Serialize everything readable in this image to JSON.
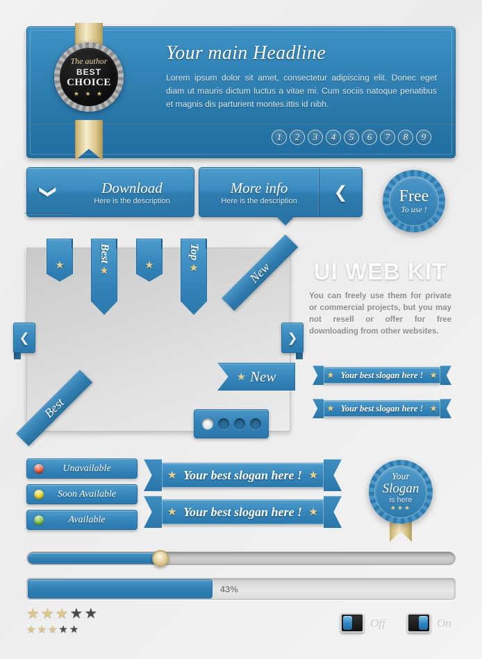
{
  "header": {
    "headline": "Your main Headline",
    "paragraph": "Lorem ipsum dolor sit amet, consectetur adipiscing elit. Donec eget diam ut mauris dictum luctus a vitae mi. Cum sociis natoque penatibus et magnis dis parturient montes.ittis id nibh.",
    "pagination": [
      "1",
      "2",
      "3",
      "4",
      "5",
      "6",
      "7",
      "8",
      "9"
    ]
  },
  "author_badge": {
    "author_line": "The author",
    "best": "BEST",
    "choice": "CHOICE",
    "stars": "★ ★ ★"
  },
  "buttons": {
    "download": {
      "title": "Download",
      "description": "Here is the description",
      "icon": "chevron-down-icon",
      "glyph": "❯"
    },
    "more_info": {
      "title": "More info",
      "description": "Here is the description",
      "icon": "chevron-left-icon",
      "glyph": "❮"
    }
  },
  "free_badge": {
    "line1": "Free",
    "line2": "To use !"
  },
  "bookmarks": [
    {
      "label": "",
      "star": "★",
      "name": "bookmark-star-1"
    },
    {
      "label": "Best",
      "star": "★",
      "name": "bookmark-best"
    },
    {
      "label": "",
      "star": "★",
      "name": "bookmark-star-2"
    },
    {
      "label": "Top",
      "star": "★",
      "name": "bookmark-top"
    }
  ],
  "corner_ribbons": {
    "top_right": "New",
    "bottom_left": "Best"
  },
  "panel_nav": {
    "prev_glyph": "❮",
    "next_glyph": "❯"
  },
  "new_banner": {
    "star": "★",
    "text": "New"
  },
  "dots": {
    "count": 4,
    "active_index": 0
  },
  "kit": {
    "title": "UI WEB KIT",
    "paragraph": "You can freely use them for private or commercial projects, but you may not resell or offer for free downloading from other websites."
  },
  "slogan_ribbons_small": [
    {
      "text": "Your best slogan here !",
      "star": "★"
    },
    {
      "text": "Your best slogan here !",
      "star": "★"
    }
  ],
  "slogan_ribbons_large": [
    {
      "text": "Your best slogan here !",
      "star": "★"
    },
    {
      "text": "Your best slogan here !",
      "star": "★"
    }
  ],
  "status_buttons": [
    {
      "label": "Unavailable",
      "color": "#e8543a"
    },
    {
      "label": "Soon Available",
      "color": "#edd225"
    },
    {
      "label": "Available",
      "color": "#7fc442"
    }
  ],
  "seal": {
    "your": "Your",
    "slogan": "Slogan",
    "is_here": "is here",
    "stars": "★★★"
  },
  "slider": {
    "value_percent": 31
  },
  "progress": {
    "value_percent": 43,
    "label": "43%"
  },
  "ratings": [
    {
      "name": "rating-large",
      "filled": 3,
      "total": 5,
      "glyph": "★"
    },
    {
      "name": "rating-small",
      "filled": 3,
      "total": 5,
      "glyph": "★"
    }
  ],
  "toggles": [
    {
      "label": "Off",
      "state": "off"
    },
    {
      "label": "On",
      "state": "on"
    }
  ],
  "colors": {
    "accent_blue": "#2f7fb2",
    "accent_blue_light": "#4e9ccb",
    "gold": "#e4ce90",
    "panel_gray": "#d8d8d8"
  }
}
